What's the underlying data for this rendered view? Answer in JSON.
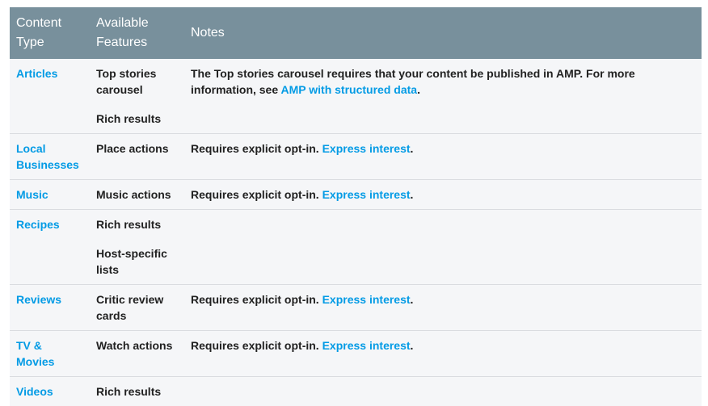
{
  "header": {
    "col1": "Content Type",
    "col2": "Available Features",
    "col3": "Notes"
  },
  "rows": [
    {
      "content_type": "Articles",
      "features": [
        "Top stories carousel",
        "Rich results"
      ],
      "note_text": "The Top stories carousel requires that your content be published in AMP. For more information, see ",
      "note_link": "AMP with structured data",
      "note_end": "."
    },
    {
      "content_type": "Local Businesses",
      "features": [
        "Place actions"
      ],
      "note_text": "Requires explicit opt-in. ",
      "note_link": "Express interest",
      "note_end": "."
    },
    {
      "content_type": "Music",
      "features": [
        "Music actions"
      ],
      "note_text": "Requires explicit opt-in. ",
      "note_link": "Express interest",
      "note_end": "."
    },
    {
      "content_type": "Recipes",
      "features": [
        "Rich results",
        "Host-specific lists"
      ],
      "note_text": "",
      "note_link": "",
      "note_end": ""
    },
    {
      "content_type": "Reviews",
      "features": [
        "Critic review cards"
      ],
      "note_text": "Requires explicit opt-in. ",
      "note_link": "Express interest",
      "note_end": "."
    },
    {
      "content_type": "TV & Movies",
      "features": [
        "Watch actions"
      ],
      "note_text": "Requires explicit opt-in. ",
      "note_link": "Express interest",
      "note_end": "."
    },
    {
      "content_type": "Videos",
      "features": [
        "Rich results"
      ],
      "note_text": "",
      "note_link": "",
      "note_end": ""
    }
  ],
  "colors": {
    "header_bg": "#78909c",
    "row_bg": "#f5f6f8",
    "link": "#039be5"
  }
}
